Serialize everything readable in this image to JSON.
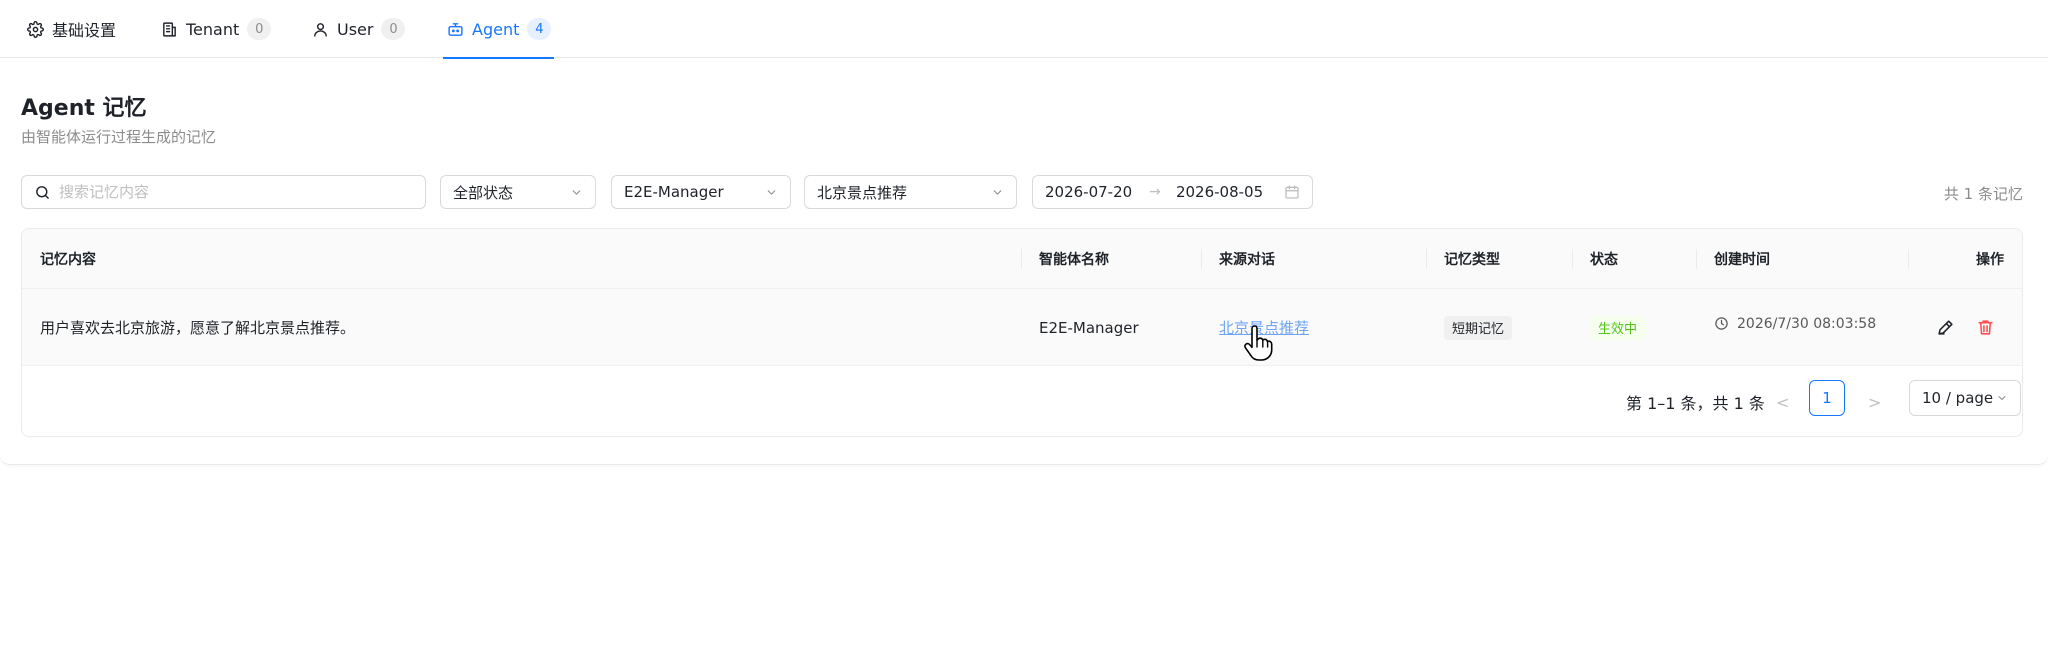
{
  "tabs": [
    {
      "label": "基础设置",
      "icon": "gear-icon",
      "count": null,
      "active": false
    },
    {
      "label": "Tenant",
      "icon": "building-icon",
      "count": "0",
      "active": false
    },
    {
      "label": "User",
      "icon": "user-icon",
      "count": "0",
      "active": false
    },
    {
      "label": "Agent",
      "icon": "robot-icon",
      "count": "4",
      "active": true
    }
  ],
  "page": {
    "title": "Agent 记忆",
    "subtitle": "由智能体运行过程生成的记忆"
  },
  "filters": {
    "search_placeholder": "搜索记忆内容",
    "search_value": "",
    "status": "全部状态",
    "agent": "E2E-Manager",
    "conversation": "北京景点推荐",
    "date_start": "2026-07-20",
    "date_arrow": "→",
    "date_end": "2026-08-05",
    "total": "共 1 条记忆"
  },
  "table": {
    "columns": [
      "记忆内容",
      "智能体名称",
      "来源对话",
      "记忆类型",
      "状态",
      "创建时间",
      "操作"
    ],
    "rows": [
      {
        "content": "用户喜欢去北京旅游，愿意了解北京景点推荐。",
        "agent": "E2E-Manager",
        "conversation": "北京景点推荐",
        "type": "短期记忆",
        "status": "生效中",
        "created": "2026/7/30 08:03:58"
      }
    ]
  },
  "pagination": {
    "summary": "第 1–1 条，共 1 条",
    "prev": "<",
    "page": "1",
    "next": ">",
    "page_size": "10 / page"
  },
  "colors": {
    "accent": "#1677ff",
    "link": "#6ea4f5",
    "success": "#52c41a",
    "danger": "#ff4d4f"
  }
}
